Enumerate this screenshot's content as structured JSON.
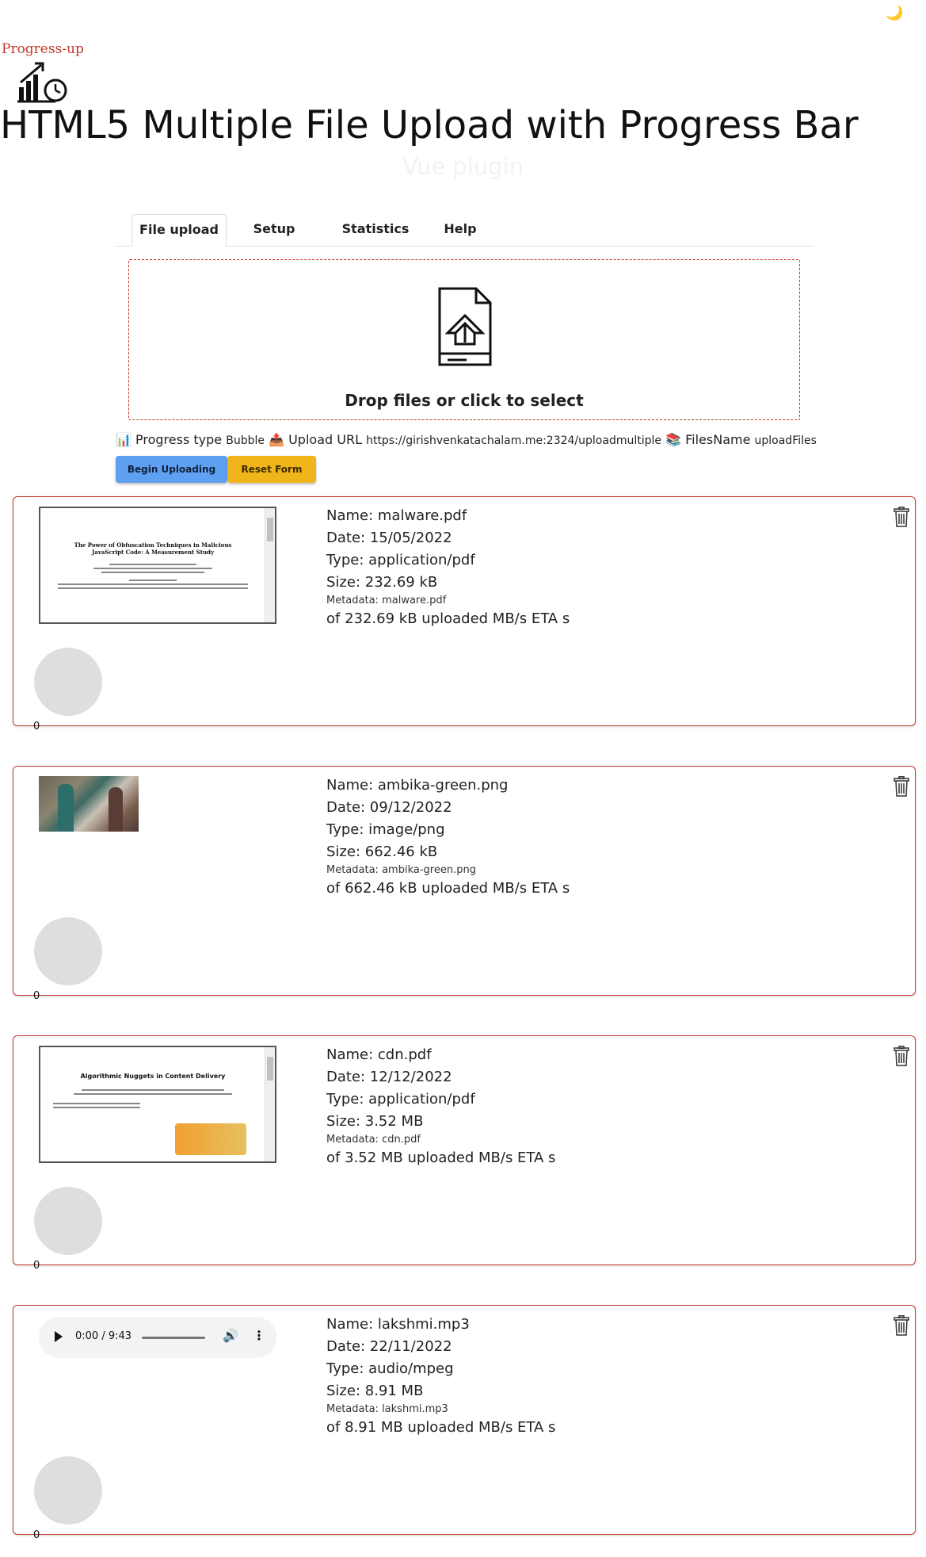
{
  "header": {
    "theme_toggle_icon": "moon-icon",
    "brand": "Progress-up",
    "logo_icon": "growth-chart-clock-icon",
    "title": "HTML5 Multiple File Upload with Progress Bar",
    "subtitle": "Vue plugin"
  },
  "tabs": [
    {
      "label": "File upload",
      "active": true
    },
    {
      "label": "Setup",
      "active": false
    },
    {
      "label": "Statistics",
      "active": false
    },
    {
      "label": "Help",
      "active": false
    }
  ],
  "dropzone": {
    "icon": "file-upload-icon",
    "label": "Drop files or click to select"
  },
  "options": {
    "progress_type_icon": "📊",
    "progress_type_label": "Progress type",
    "progress_type_value": "Bubble",
    "upload_url_icon": "📤",
    "upload_url_label": "Upload URL",
    "upload_url_value": "https://girishvenkatachalam.me:2324/uploadmultiple",
    "files_name_icon": "📚",
    "files_name_label": "FilesName",
    "files_name_value": "uploadFiles"
  },
  "buttons": {
    "begin": "Begin Uploading",
    "reset": "Reset Form"
  },
  "files": [
    {
      "preview": "pdf",
      "pdf_title": "The Power of Obfuscation Techniques in Malicious JavaScript Code: A Measurement Study",
      "name_line": "Name: malware.pdf",
      "date_line": "Date: 15/05/2022",
      "type_line": "Type: application/pdf",
      "size_line": "Size: 232.69 kB",
      "metadata_line": "Metadata: malware.pdf",
      "progress_line": "of 232.69 kB uploaded MB/s ETA s",
      "progress_value": "0",
      "progress_fraction": 0
    },
    {
      "preview": "image",
      "name_line": "Name: ambika-green.png",
      "date_line": "Date: 09/12/2022",
      "type_line": "Type: image/png",
      "size_line": "Size: 662.46 kB",
      "metadata_line": "Metadata: ambika-green.png",
      "progress_line": "of 662.46 kB uploaded MB/s ETA s",
      "progress_value": "0",
      "progress_fraction": 0
    },
    {
      "preview": "pdf",
      "pdf_title": "Algorithmic Nuggets in Content Delivery",
      "name_line": "Name: cdn.pdf",
      "date_line": "Date: 12/12/2022",
      "type_line": "Type: application/pdf",
      "size_line": "Size: 3.52 MB",
      "metadata_line": "Metadata: cdn.pdf",
      "progress_line": "of 3.52 MB uploaded MB/s ETA s",
      "progress_value": "0",
      "progress_fraction": 0
    },
    {
      "preview": "audio",
      "audio_time": "0:00 / 9:43",
      "name_line": "Name: lakshmi.mp3",
      "date_line": "Date: 22/11/2022",
      "type_line": "Type: audio/mpeg",
      "size_line": "Size: 8.91 MB",
      "metadata_line": "Metadata: lakshmi.mp3",
      "progress_line": "of 8.91 MB uploaded MB/s ETA s",
      "progress_value": "0",
      "progress_fraction": 0
    }
  ],
  "colors": {
    "accent_red": "#c0392b",
    "begin_button": "#5ea1f2",
    "reset_button": "#efb51a",
    "bubble": "#dedede"
  }
}
